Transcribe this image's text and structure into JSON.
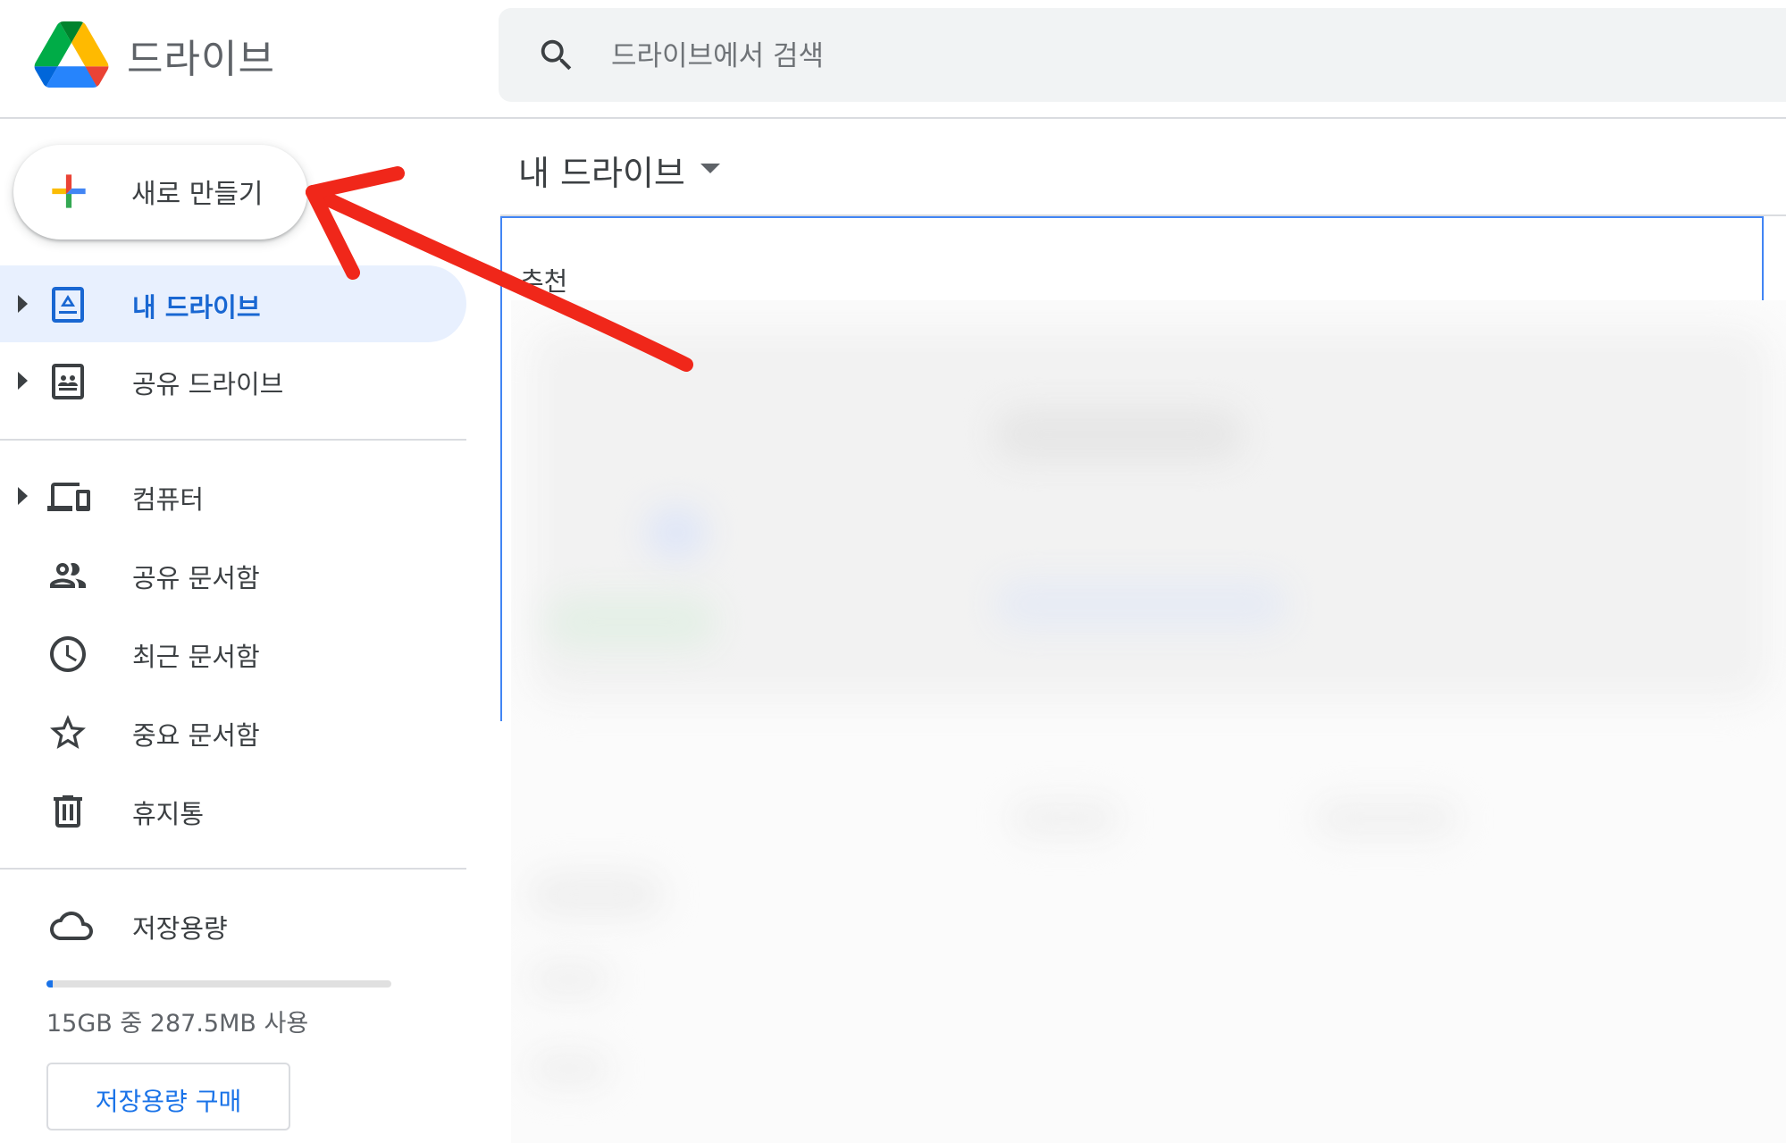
{
  "header": {
    "app_title": "드라이브",
    "search": {
      "placeholder": "드라이브에서 검색"
    }
  },
  "sidebar": {
    "new_button_label": "새로 만들기",
    "items": [
      {
        "label": "내 드라이브",
        "icon": "my-drive-icon",
        "active": true,
        "expandable": true
      },
      {
        "label": "공유 드라이브",
        "icon": "shared-drives-icon",
        "active": false,
        "expandable": true
      },
      {
        "label": "컴퓨터",
        "icon": "computers-icon",
        "active": false,
        "expandable": true
      },
      {
        "label": "공유 문서함",
        "icon": "shared-with-me-icon",
        "active": false,
        "expandable": false
      },
      {
        "label": "최근 문서함",
        "icon": "recent-icon",
        "active": false,
        "expandable": false
      },
      {
        "label": "중요 문서함",
        "icon": "starred-icon",
        "active": false,
        "expandable": false
      },
      {
        "label": "휴지통",
        "icon": "trash-icon",
        "active": false,
        "expandable": false
      },
      {
        "label": "저장용량",
        "icon": "cloud-icon",
        "active": false,
        "expandable": false
      }
    ],
    "storage": {
      "used_fraction": 0.019,
      "text": "15GB 중 287.5MB 사용",
      "buy_label": "저장용량 구매"
    }
  },
  "main": {
    "breadcrumb": "내 드라이브",
    "suggested_label": "추천"
  },
  "colors": {
    "accent": "#1a73e8",
    "active_bg": "#e8f0fe",
    "annotation_arrow": "#f0271a"
  }
}
